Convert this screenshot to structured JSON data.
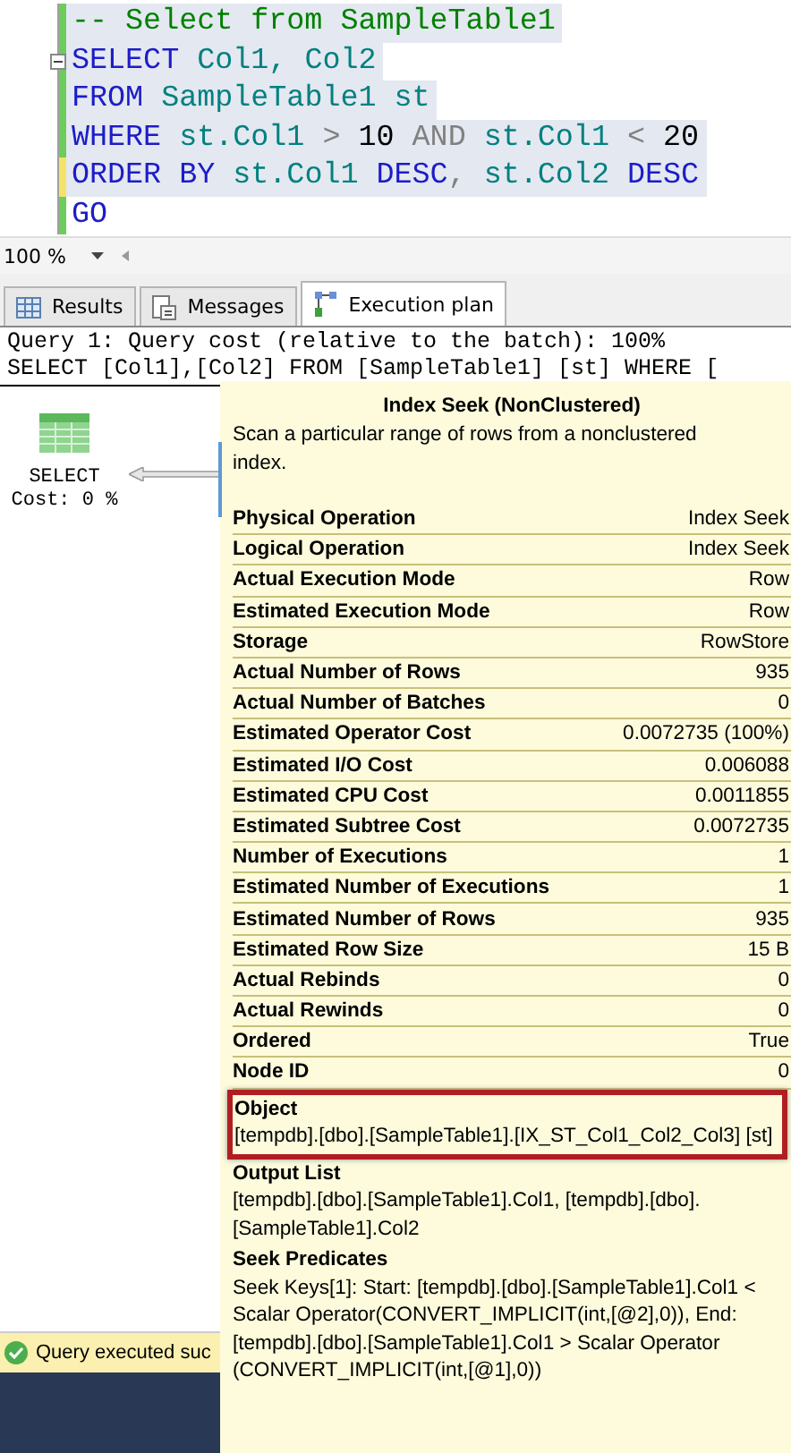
{
  "editor": {
    "lines": [
      {
        "color": "#6ccc5c",
        "foldable": false,
        "tokens": [
          {
            "kind": "comment",
            "text": "-- Select from SampleTable1"
          }
        ]
      },
      {
        "color": "#6ccc5c",
        "foldable": true,
        "tokens": [
          {
            "kind": "keyword",
            "text": "SELECT "
          },
          {
            "kind": "ident",
            "text": "Col1, Col2"
          }
        ]
      },
      {
        "color": "#6ccc5c",
        "foldable": false,
        "tokens": [
          {
            "kind": "keyword",
            "text": "FROM "
          },
          {
            "kind": "ident",
            "text": "SampleTable1 st"
          }
        ]
      },
      {
        "color": "#6ccc5c",
        "foldable": false,
        "tokens": [
          {
            "kind": "keyword",
            "text": "WHERE "
          },
          {
            "kind": "ident",
            "text": "st.Col1 "
          },
          {
            "kind": "operator",
            "text": "> "
          },
          {
            "kind": "number",
            "text": "10 "
          },
          {
            "kind": "operator",
            "text": "AND "
          },
          {
            "kind": "ident",
            "text": "st.Col1 "
          },
          {
            "kind": "operator",
            "text": "< "
          },
          {
            "kind": "number",
            "text": "20"
          }
        ]
      },
      {
        "color": "#f4e36a",
        "foldable": false,
        "tokens": [
          {
            "kind": "keyword",
            "text": "ORDER BY "
          },
          {
            "kind": "ident",
            "text": "st.Col1 "
          },
          {
            "kind": "keyword",
            "text": "DESC"
          },
          {
            "kind": "operator",
            "text": ", "
          },
          {
            "kind": "ident",
            "text": "st.Col2 "
          },
          {
            "kind": "keyword",
            "text": "DESC"
          }
        ]
      },
      {
        "color": "#6ccc5c",
        "foldable": false,
        "tokens": [
          {
            "kind": "keyword",
            "text": "GO"
          }
        ]
      }
    ],
    "zoom": "100 %"
  },
  "tabs": [
    {
      "label": "Results",
      "selected": false
    },
    {
      "label": "Messages",
      "selected": false
    },
    {
      "label": "Execution plan",
      "selected": true
    }
  ],
  "plan": {
    "header": [
      "Query 1: Query cost (relative to the batch): 100%",
      "SELECT [Col1],[Col2] FROM [SampleTable1] [st] WHERE ["
    ],
    "node": {
      "name": "SELECT",
      "cost": "Cost: 0 %"
    }
  },
  "tooltip": {
    "title": "Index Seek (NonClustered)",
    "description": "Scan a particular range of rows from a nonclustered index.",
    "properties": [
      {
        "label": "Physical Operation",
        "value": "Index Seek"
      },
      {
        "label": "Logical Operation",
        "value": "Index Seek"
      },
      {
        "label": "Actual Execution Mode",
        "value": "Row"
      },
      {
        "label": "Estimated Execution Mode",
        "value": "Row"
      },
      {
        "label": "Storage",
        "value": "RowStore"
      },
      {
        "label": "Actual Number of Rows",
        "value": "935"
      },
      {
        "label": "Actual Number of Batches",
        "value": "0"
      },
      {
        "label": "Estimated Operator Cost",
        "value": "0.0072735 (100%)"
      },
      {
        "label": "Estimated I/O Cost",
        "value": "0.006088"
      },
      {
        "label": "Estimated CPU Cost",
        "value": "0.0011855"
      },
      {
        "label": "Estimated Subtree Cost",
        "value": "0.0072735"
      },
      {
        "label": "Number of Executions",
        "value": "1"
      },
      {
        "label": "Estimated Number of Executions",
        "value": "1"
      },
      {
        "label": "Estimated Number of Rows",
        "value": "935"
      },
      {
        "label": "Estimated Row Size",
        "value": "15 B"
      },
      {
        "label": "Actual Rebinds",
        "value": "0"
      },
      {
        "label": "Actual Rewinds",
        "value": "0"
      },
      {
        "label": "Ordered",
        "value": "True"
      },
      {
        "label": "Node ID",
        "value": "0"
      }
    ],
    "sections": [
      {
        "heading": "Object",
        "text": "[tempdb].[dbo].[SampleTable1].[IX_ST_Col1_Col2_Col3] [st]",
        "highlighted": true
      },
      {
        "heading": "Output List",
        "text": "[tempdb].[dbo].[SampleTable1].Col1, [tempdb].[dbo].[SampleTable1].Col2",
        "highlighted": false
      },
      {
        "heading": "Seek Predicates",
        "text": "Seek Keys[1]: Start: [tempdb].[dbo].[SampleTable1].Col1 < Scalar Operator(CONVERT_IMPLICIT(int,[@2],0)), End: [tempdb].[dbo].[SampleTable1].Col1 > Scalar Operator (CONVERT_IMPLICIT(int,[@1],0))",
        "highlighted": false
      }
    ]
  },
  "status_bar": {
    "text": "Query executed suc",
    "success": true
  }
}
